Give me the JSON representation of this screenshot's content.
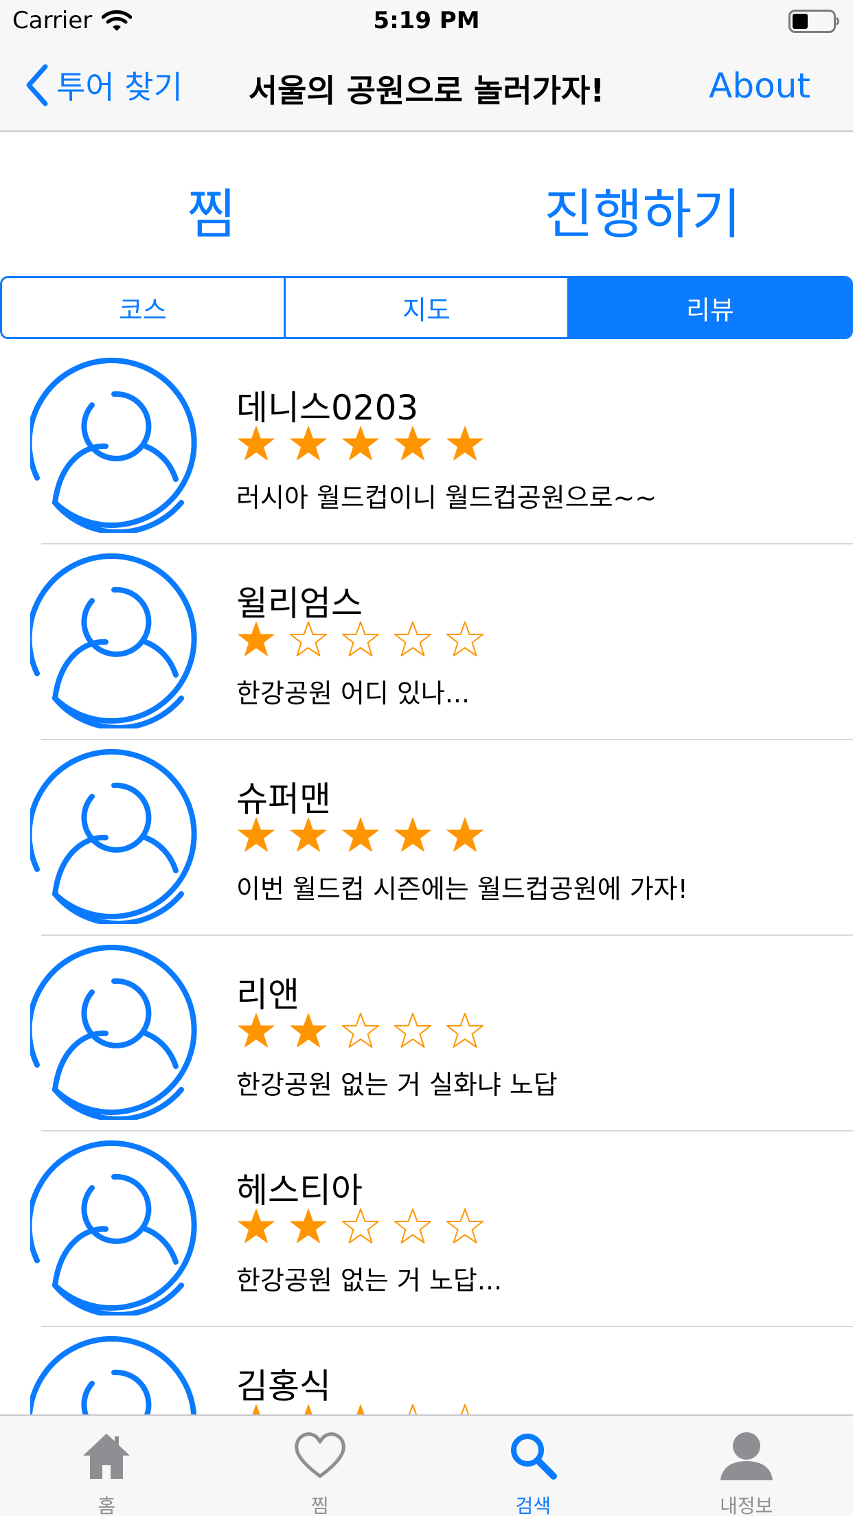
{
  "status_bar": {
    "carrier": "Carrier",
    "time": "5:19 PM"
  },
  "nav": {
    "back_label": "투어 찾기",
    "title": "서울의 공원으로 놀러가자!",
    "right_label": "About"
  },
  "actions": {
    "zzim_label": "찜",
    "proceed_label": "진행하기"
  },
  "segments": [
    {
      "label": "코스",
      "selected": false
    },
    {
      "label": "지도",
      "selected": false
    },
    {
      "label": "리뷰",
      "selected": true
    }
  ],
  "reviews": [
    {
      "name": "데니스0203",
      "rating": 5,
      "text": "러시아 월드컵이니 월드컵공원으로~~"
    },
    {
      "name": "윌리엄스",
      "rating": 1,
      "text": "한강공원 어디 있나..."
    },
    {
      "name": "슈퍼맨",
      "rating": 5,
      "text": "이번 월드컵 시즌에는 월드컵공원에 가자!"
    },
    {
      "name": "리앤",
      "rating": 2,
      "text": "한강공원 없는 거 실화냐 노답"
    },
    {
      "name": "헤스티아",
      "rating": 2,
      "text": "한강공원 없는 거 노답..."
    },
    {
      "name": "김홍식",
      "rating": 3,
      "text": ""
    }
  ],
  "rating_max": 5,
  "tabs": [
    {
      "label": "홈",
      "icon": "home-icon",
      "active": false
    },
    {
      "label": "찜",
      "icon": "heart-icon",
      "active": false
    },
    {
      "label": "검색",
      "icon": "search-icon",
      "active": true
    },
    {
      "label": "내정보",
      "icon": "profile-icon",
      "active": false
    }
  ],
  "colors": {
    "accent": "#0a7aff",
    "star": "#ff9500",
    "inactive_tab": "#8e8e93"
  }
}
